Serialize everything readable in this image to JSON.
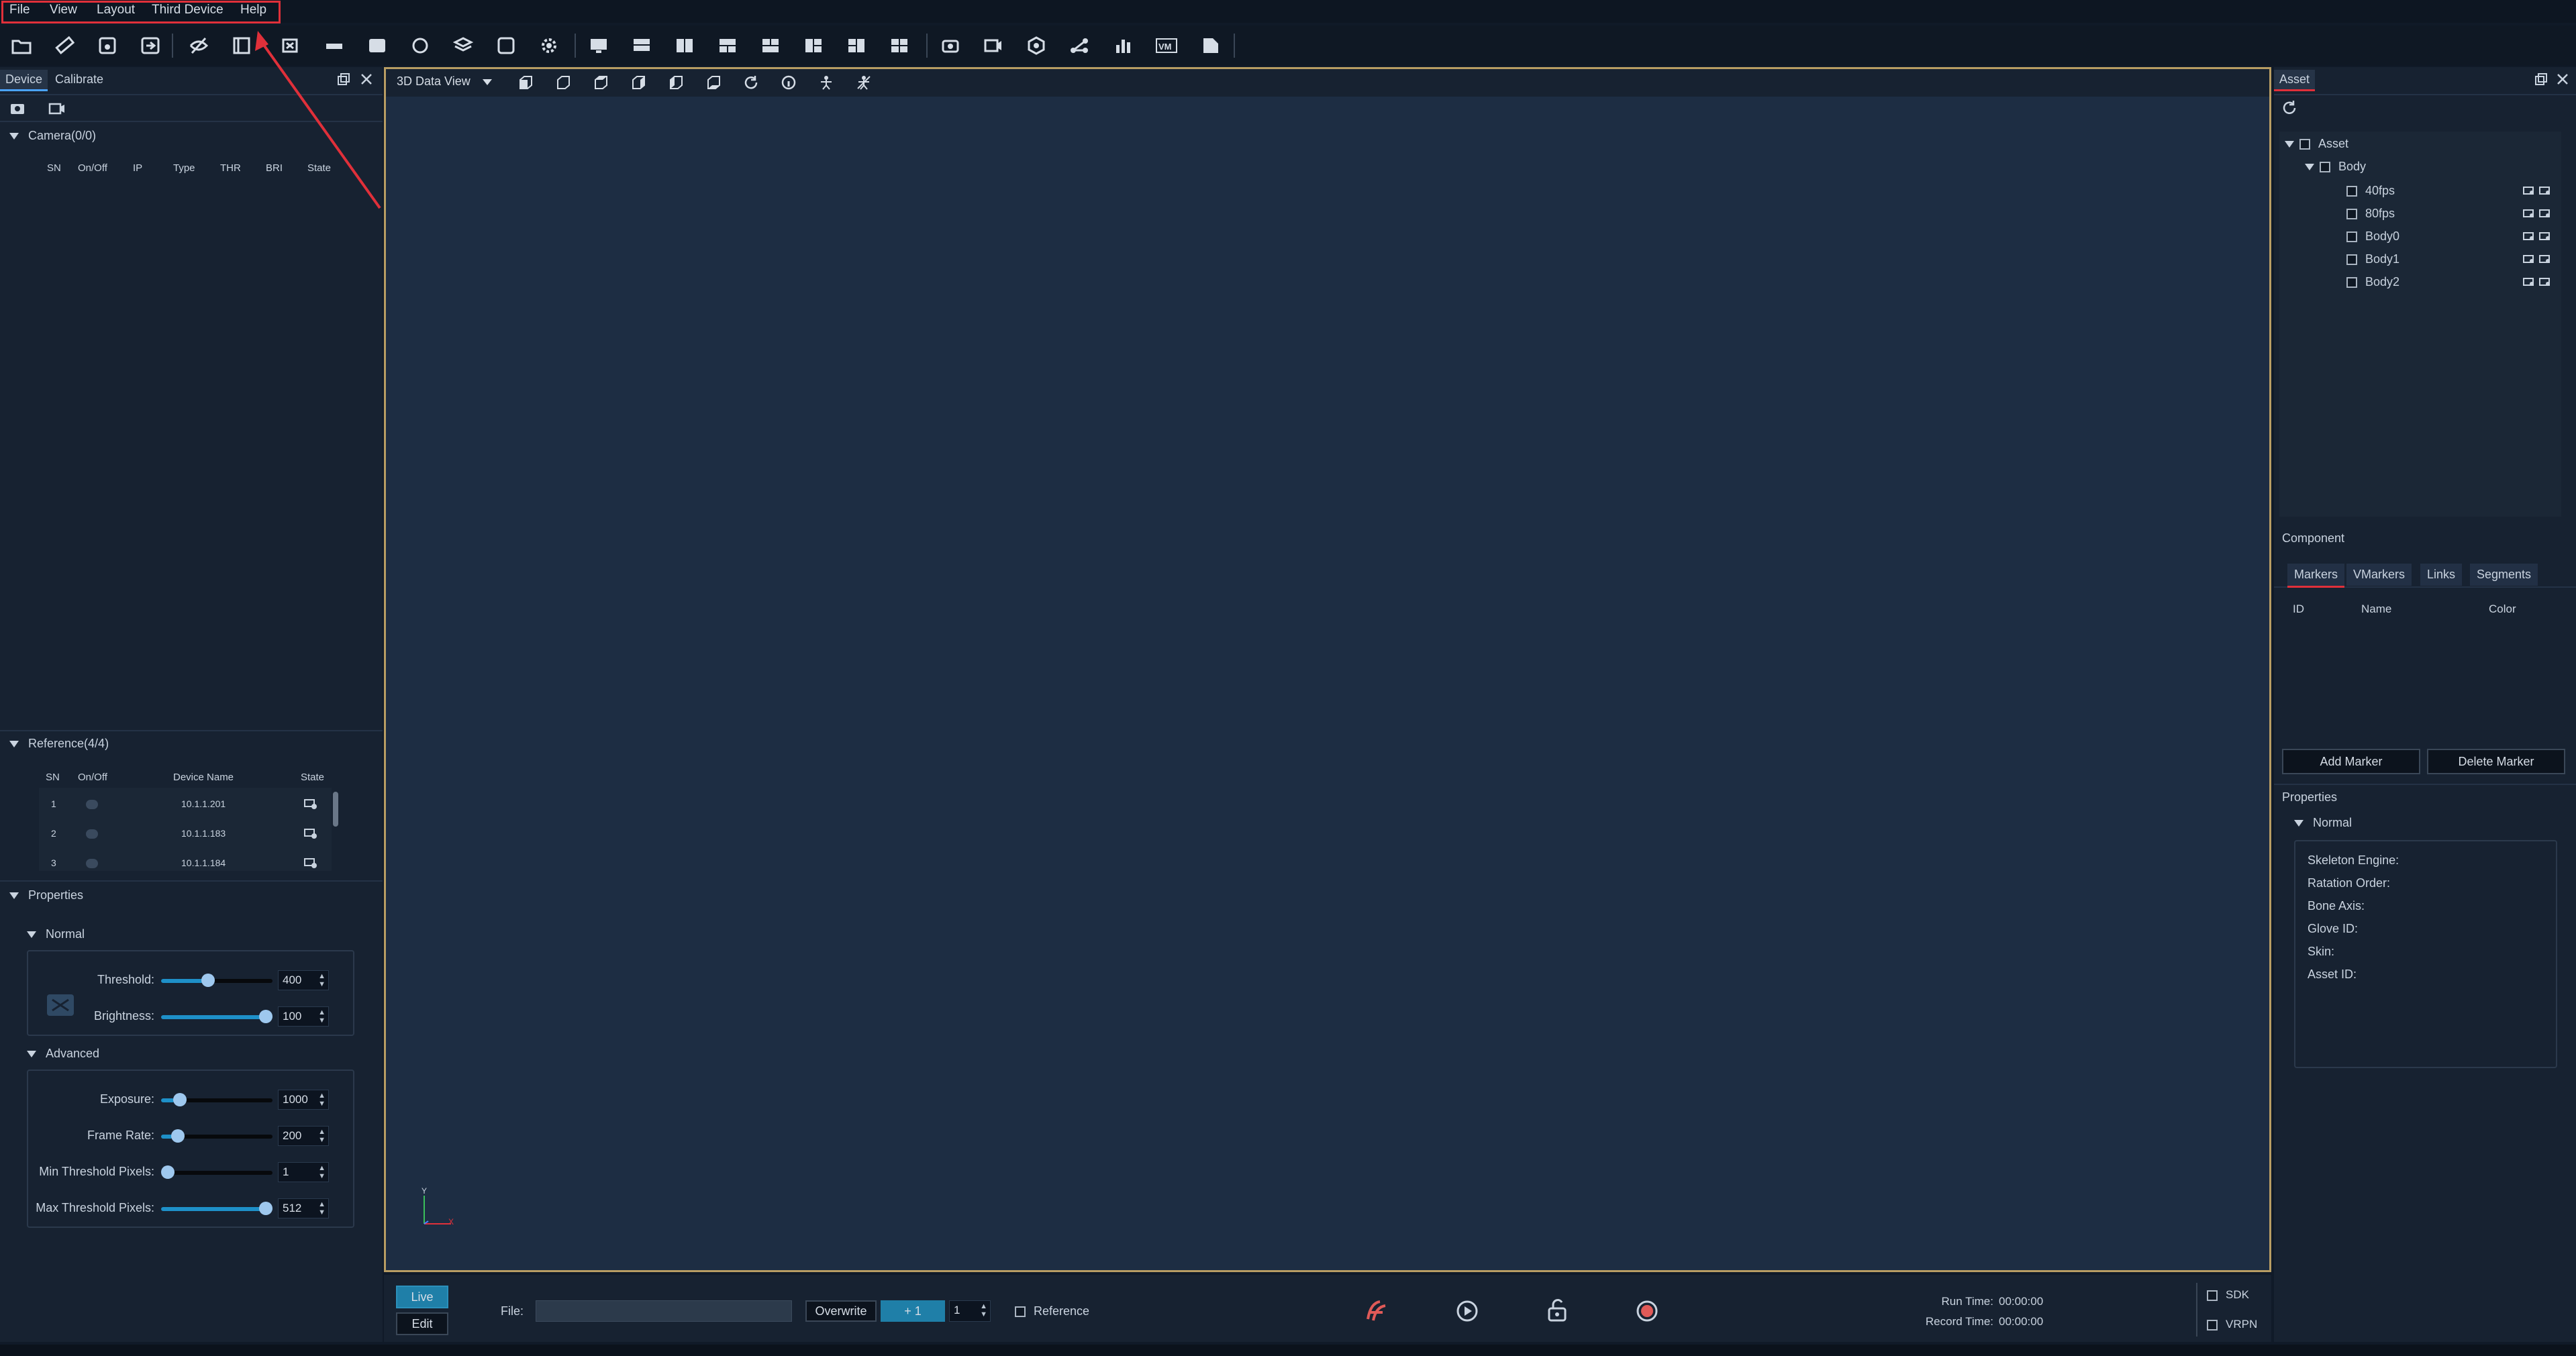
{
  "menubar": {
    "items": [
      "File",
      "View",
      "Layout",
      "Third Device",
      "Help"
    ]
  },
  "toolbar": {
    "icons": [
      "open-folder-icon",
      "ruler-icon",
      "save-disk-icon",
      "save-as-icon",
      "eye-off-icon",
      "swap-icon",
      "camera-x-icon",
      "calibration-bar-icon",
      "video-icon",
      "rotate-icon",
      "layers-icon",
      "wand-icon",
      "gear-icon",
      "monitor-layout-1-icon",
      "monitor-layout-2-icon",
      "layout-3-icon",
      "layout-4-icon",
      "layout-5-icon",
      "layout-6-icon",
      "layout-7-icon",
      "layout-8-icon",
      "camera-rotate-icon",
      "video-camera-icon",
      "hexagon-icon",
      "share-nodes-icon",
      "bar-chart-icon",
      "vm-icon",
      "export-icon"
    ]
  },
  "left": {
    "tabs": [
      "Device",
      "Calibrate"
    ],
    "camera_header": "Camera(0/0)",
    "camera_columns": [
      "SN",
      "On/Off",
      "IP",
      "Type",
      "THR",
      "BRI",
      "State"
    ],
    "reference_header": "Reference(4/4)",
    "reference_columns": [
      "SN",
      "On/Off",
      "Device Name",
      "State"
    ],
    "reference_rows": [
      {
        "sn": "1",
        "name": "10.1.1.201"
      },
      {
        "sn": "2",
        "name": "10.1.1.183"
      },
      {
        "sn": "3",
        "name": "10.1.1.184"
      }
    ],
    "properties_header": "Properties",
    "normal_header": "Normal",
    "advanced_header": "Advanced",
    "normal_fields": [
      {
        "label": "Threshold:",
        "value": "400",
        "fraction": 0.41
      },
      {
        "label": "Brightness:",
        "value": "100",
        "fraction": 1.0
      }
    ],
    "advanced_fields": [
      {
        "label": "Exposure:",
        "value": "1000",
        "fraction": 0.12
      },
      {
        "label": "Frame Rate:",
        "value": "200",
        "fraction": 0.1
      },
      {
        "label": "Min Threshold Pixels:",
        "value": "1",
        "fraction": 0.0
      },
      {
        "label": "Max Threshold Pixels:",
        "value": "512",
        "fraction": 1.0
      }
    ]
  },
  "center": {
    "view_label": "3D Data View",
    "axis": {
      "x": "X",
      "y": "Y"
    }
  },
  "bottom": {
    "live_label": "Live",
    "edit_label": "Edit",
    "file_label": "File:",
    "file_value": "",
    "overwrite_label": "Overwrite",
    "plus_label": "+ 1",
    "spin_value": "1",
    "reference_label": "Reference",
    "run_time_label": "Run Time:",
    "run_time_value": "00:00:00",
    "record_time_label": "Record Time:",
    "record_time_value": "00:00:00",
    "sdk_label": "SDK",
    "vrpn_label": "VRPN"
  },
  "right": {
    "tab": "Asset",
    "tree_root": "Asset",
    "tree_group": "Body",
    "tree_items": [
      "40fps",
      "80fps",
      "Body0",
      "Body1",
      "Body2"
    ],
    "component_label": "Component",
    "component_tabs": [
      "Markers",
      "VMarkers",
      "Links",
      "Segments"
    ],
    "marker_columns": [
      "ID",
      "Name",
      "Color"
    ],
    "add_marker": "Add Marker",
    "delete_marker": "Delete Marker",
    "properties_label": "Properties",
    "normal_label": "Normal",
    "prop_fields": [
      "Skeleton Engine:",
      "Ratation Order:",
      "Bone Axis:",
      "Glove ID:",
      "Skin:",
      "Asset ID:"
    ]
  },
  "colors": {
    "accent": "#1e90c8",
    "highlight": "#e0303a",
    "frame": "#b89d63",
    "live_btn": "#1f7fa8"
  }
}
